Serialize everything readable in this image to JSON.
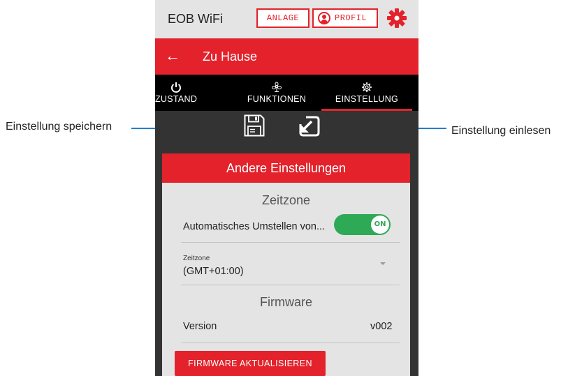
{
  "header": {
    "app_title": "EOB WiFi",
    "anlage_label": "ANLAGE",
    "profil_label": "PROFIL",
    "settings_icon": "gear-icon"
  },
  "nav": {
    "back_icon": "←",
    "breadcrumb": "Zu Hause"
  },
  "tabs": [
    {
      "label": "ZUSTAND",
      "icon": "power-icon"
    },
    {
      "label": "FUNKTIONEN",
      "icon": "fan-icon"
    },
    {
      "label": "EINSTELLUNG",
      "icon": "gear-icon",
      "active": true
    }
  ],
  "actions": {
    "save_icon": "floppy-disk-icon",
    "load_icon": "import-icon"
  },
  "annotations": {
    "left": "Einstellung speichern",
    "right": "Einstellung einlesen"
  },
  "card": {
    "title": "Andere Einstellungen",
    "timezone_section": "Zeitzone",
    "auto_switch_label": "Automatisches Umstellen von...",
    "toggle_text": "ON",
    "timezone_field_label": "Zeitzone",
    "timezone_value": "(GMT+01:00)",
    "firmware_section": "Firmware",
    "version_label": "Version",
    "version_value": "v002",
    "update_button": "FIRMWARE AKTUALISIEREN"
  },
  "colors": {
    "brand_red": "#e3222b",
    "toggle_green": "#2ea955",
    "arrow_blue": "#1f7fd1"
  }
}
